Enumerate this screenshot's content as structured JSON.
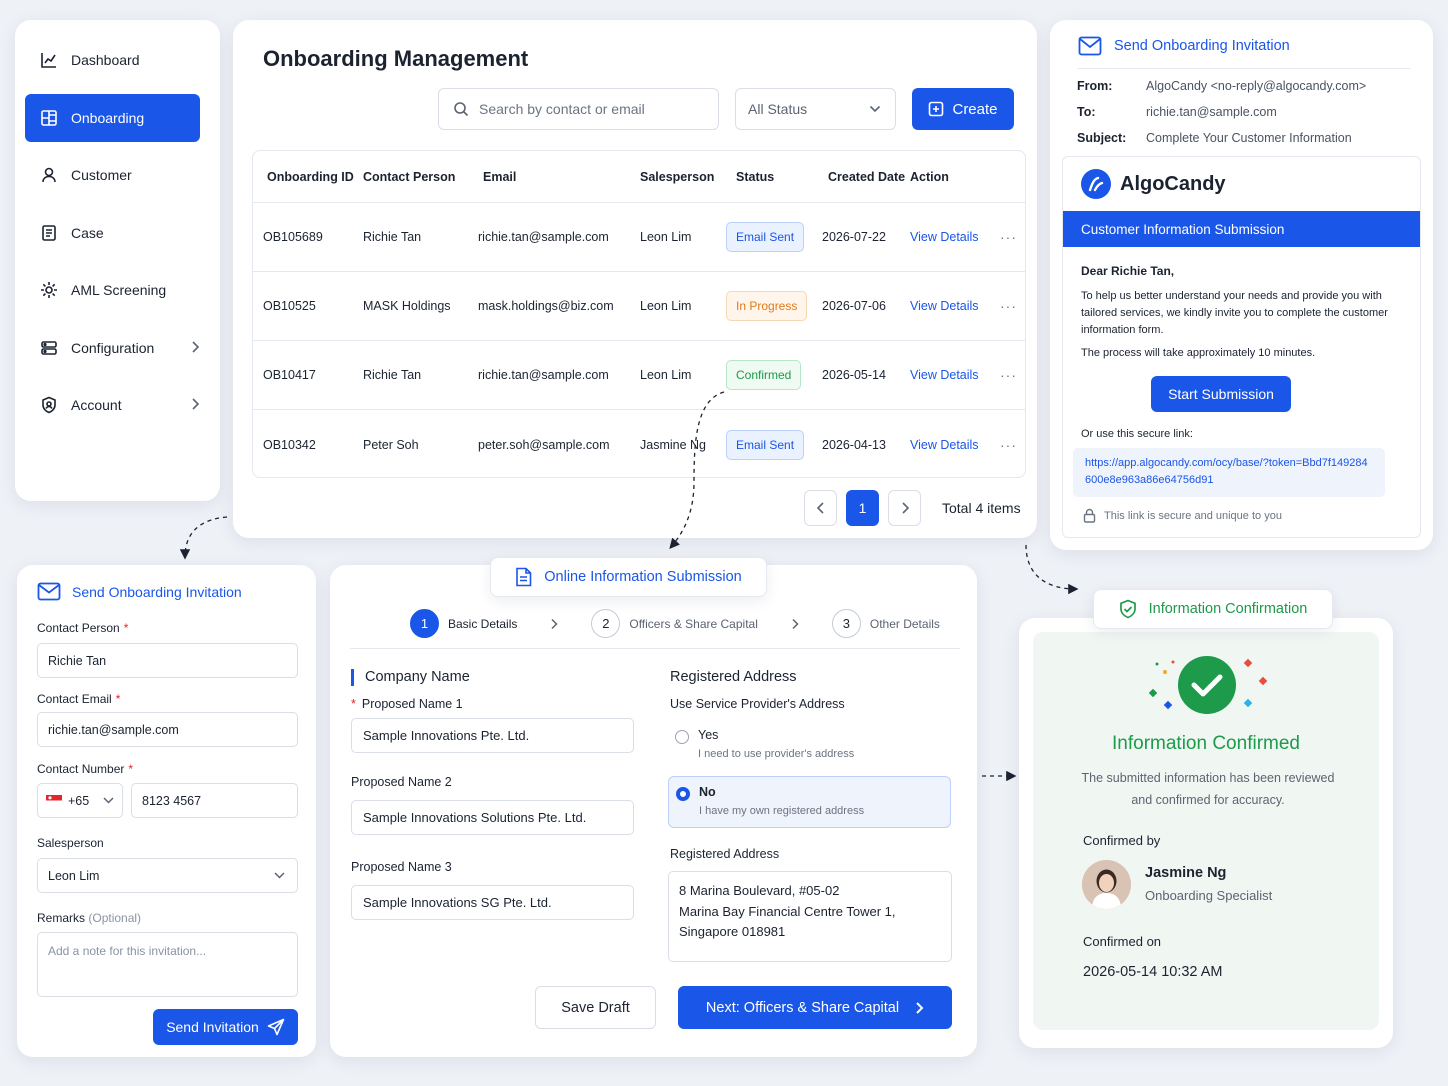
{
  "sidebar": {
    "items": [
      {
        "label": "Dashboard",
        "icon": "chart-line-icon"
      },
      {
        "label": "Onboarding",
        "icon": "grid-icon"
      },
      {
        "label": "Customer",
        "icon": "user-icon"
      },
      {
        "label": "Case",
        "icon": "file-icon"
      },
      {
        "label": "AML Screening",
        "icon": "scan-icon"
      },
      {
        "label": "Configuration",
        "icon": "config-icon"
      },
      {
        "label": "Account",
        "icon": "shield-icon"
      }
    ]
  },
  "management": {
    "title": "Onboarding Management",
    "search_placeholder": "Search by contact or email",
    "status_filter": "All Status",
    "create_label": "Create",
    "columns": [
      "Onboarding ID",
      "Contact Person",
      "Email",
      "Salesperson",
      "Status",
      "Created Date",
      "Action"
    ],
    "rows": [
      {
        "id": "OB105689",
        "contact": "Richie Tan",
        "email": "richie.tan@sample.com",
        "sales": "Leon Lim",
        "status": "Email Sent",
        "date": "2026-07-22",
        "action": "View Details"
      },
      {
        "id": "OB10525",
        "contact": "MASK Holdings",
        "email": "mask.holdings@biz.com",
        "sales": "Leon Lim",
        "status": "In Progress",
        "date": "2026-07-06",
        "action": "View Details"
      },
      {
        "id": "OB10417",
        "contact": "Richie Tan",
        "email": "richie.tan@sample.com",
        "sales": "Leon Lim",
        "status": "Confirmed",
        "date": "2026-05-14",
        "action": "View Details"
      },
      {
        "id": "OB10342",
        "contact": "Peter Soh",
        "email": "peter.soh@sample.com",
        "sales": "Jasmine Ng",
        "status": "Email Sent",
        "date": "2026-04-13",
        "action": "View Details"
      }
    ],
    "more": "···",
    "page": "1",
    "total": "Total 4 items"
  },
  "email": {
    "header": "Send Onboarding Invitation",
    "from_label": "From:",
    "from_value": "AlgoCandy <no-reply@algocandy.com>",
    "to_label": "To:",
    "to_value": "richie.tan@sample.com",
    "subject_label": "Subject:",
    "subject_value": "Complete Your Customer Information",
    "brand": "AlgoCandy",
    "banner": "Customer Information Submission",
    "greeting": "Dear Richie Tan,",
    "body": "To help us better understand your needs and provide you with tailored services, we kindly invite you to complete the customer information form.",
    "duration": "The process will take approximately 10 minutes.",
    "start_label": "Start Submission",
    "link_label": "Or use this secure link:",
    "link": "https://app.algocandy.com/ocy/base/?token=Bbd7f149284600e8e963a86e64756d91",
    "secure_note": "This link is secure and unique to you"
  },
  "invite": {
    "header": "Send Onboarding Invitation",
    "contact_label": "Contact Person",
    "contact_value": "Richie Tan",
    "email_label": "Contact Email",
    "email_value": "richie.tan@sample.com",
    "number_label": "Contact Number",
    "country_code": "+65",
    "number_value": "8123 4567",
    "sales_label": "Salesperson",
    "sales_value": "Leon Lim",
    "remarks_label": "Remarks",
    "remarks_optional": "(Optional)",
    "remarks_placeholder": "Add a note for this invitation...",
    "send_label": "Send Invitation",
    "required_mark": "*"
  },
  "submission": {
    "tab": "Online Information Submission",
    "steps": [
      {
        "num": "1",
        "label": "Basic Details"
      },
      {
        "num": "2",
        "label": "Officers & Share Capital"
      },
      {
        "num": "3",
        "label": "Other Details"
      }
    ],
    "company_title": "Company Name",
    "name1_label": "Proposed Name 1",
    "name1_value": "Sample Innovations Pte. Ltd.",
    "name2_label": "Proposed Name 2",
    "name2_value": "Sample Innovations Solutions Pte. Ltd.",
    "name3_label": "Proposed Name 3",
    "name3_value": "Sample Innovations SG Pte. Ltd.",
    "address_title": "Registered Address",
    "provider_label": "Use Service Provider's Address",
    "yes_label": "Yes",
    "yes_sub": "I need to use provider's address",
    "no_label": "No",
    "no_sub": "I have my own registered address",
    "reg_label": "Registered Address",
    "addr_line1": "8 Marina Boulevard, #05-02",
    "addr_line2": "Marina Bay Financial Centre Tower 1,",
    "addr_line3": "Singapore 018981",
    "draft_label": "Save Draft",
    "next_label": "Next: Officers & Share Capital"
  },
  "confirmation": {
    "tab": "Information Confirmation",
    "title": "Information Confirmed",
    "desc": "The submitted information has been reviewed and confirmed for accuracy.",
    "by_label": "Confirmed by",
    "name": "Jasmine Ng",
    "role": "Onboarding Specialist",
    "on_label": "Confirmed on",
    "date": "2026-05-14 10:32 AM"
  },
  "colors": {
    "primary": "#1a56e8",
    "success": "#1d9a4a",
    "warning": "#e07b1a"
  }
}
